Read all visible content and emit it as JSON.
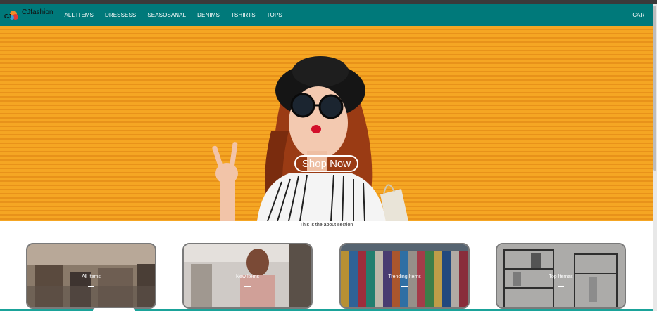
{
  "brand": {
    "name": "CJfashion",
    "logo_text": "CJ"
  },
  "nav": {
    "items": [
      "ALL ITEMS",
      "DRESSESS",
      "SEASOSANAL",
      "DENIMS",
      "TSHIRTS",
      "TOPS"
    ],
    "cart": "CART"
  },
  "hero": {
    "button": "Shop Now"
  },
  "about": {
    "text": "This is the about section"
  },
  "categories": [
    {
      "label": "All Items"
    },
    {
      "label": "New Items"
    },
    {
      "label": "Trending Items"
    },
    {
      "label": "Top Itemas"
    }
  ],
  "colors": {
    "navbar": "#00797a",
    "hero_orange": "#f5a623",
    "accent_strip": "#1aa39a"
  }
}
